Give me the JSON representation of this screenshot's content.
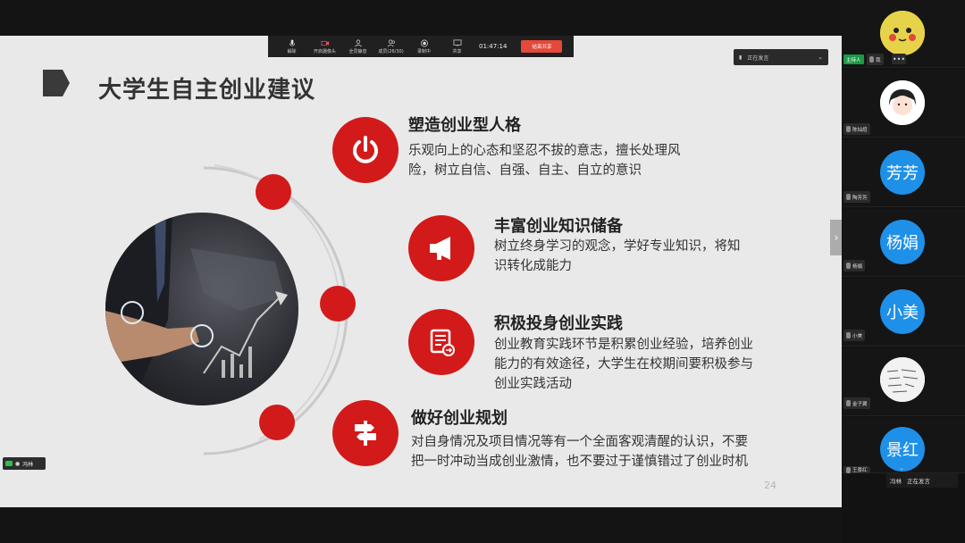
{
  "toolbar": {
    "buttons": [
      {
        "label": "解除",
        "icon": "microphone-icon"
      },
      {
        "label": "开启摄像头",
        "icon": "camera-off-icon"
      },
      {
        "label": "全员静音",
        "icon": "mute-all-icon"
      },
      {
        "label": "成员(26/30)",
        "icon": "members-icon"
      },
      {
        "label": "录制中",
        "icon": "record-icon"
      },
      {
        "label": "共享",
        "icon": "share-screen-icon"
      }
    ],
    "time": "01:47:14",
    "end_label": "结束共享"
  },
  "speaking": {
    "label": "正在发言"
  },
  "slide": {
    "title": "大学生自主创业建议",
    "page": "24",
    "items": [
      {
        "title": "塑造创业型人格",
        "text": [
          "乐观向上的心态和坚忍不拔的意志，擅长处理风",
          "险，树立自信、自强、自主、自立的意识"
        ],
        "icon": "power-icon"
      },
      {
        "title": "丰富创业知识储备",
        "text": [
          "树立终身学习的观念，学好专业知识，将知",
          "识转化成能力"
        ],
        "icon": "megaphone-icon"
      },
      {
        "title": "积极投身创业实践",
        "text": [
          "创业教育实践环节是积累创业经验，培养创业",
          "能力的有效途径，大学生在校期间要积极参与",
          "创业实践活动"
        ],
        "icon": "document-icon"
      },
      {
        "title": "做好创业规划",
        "text": [
          "对自身情况及项目情况等有一个全面客观清醒的认识，不要",
          "把一时冲动当成创业激情，也不要过于谨慎错过了创业时机"
        ],
        "icon": "signpost-icon"
      }
    ]
  },
  "self_tag": {
    "name": "冯林"
  },
  "participants": [
    {
      "name": "我",
      "avatar_text": "",
      "color": "#e6d34a",
      "host": "主持人"
    },
    {
      "name": "陈灿煊",
      "avatar_text": "",
      "color": "#ffffff"
    },
    {
      "name": "陶芳芳",
      "avatar_text": "芳芳",
      "color": "#1e90e8"
    },
    {
      "name": "杨娟",
      "avatar_text": "杨娟",
      "color": "#1e90e8"
    },
    {
      "name": "小美",
      "avatar_text": "小美",
      "color": "#1e90e8"
    },
    {
      "name": "金子翼",
      "avatar_text": "",
      "color": "#f2f2f2"
    },
    {
      "name": "王景红",
      "avatar_text": "景红",
      "color": "#1e90e8"
    }
  ],
  "bottom_speaker": {
    "name": "冯林",
    "status": "正在发言"
  },
  "colors": {
    "accent": "#d21a1a",
    "toolbar": "#202020",
    "avatar_blue": "#1e90e8"
  }
}
